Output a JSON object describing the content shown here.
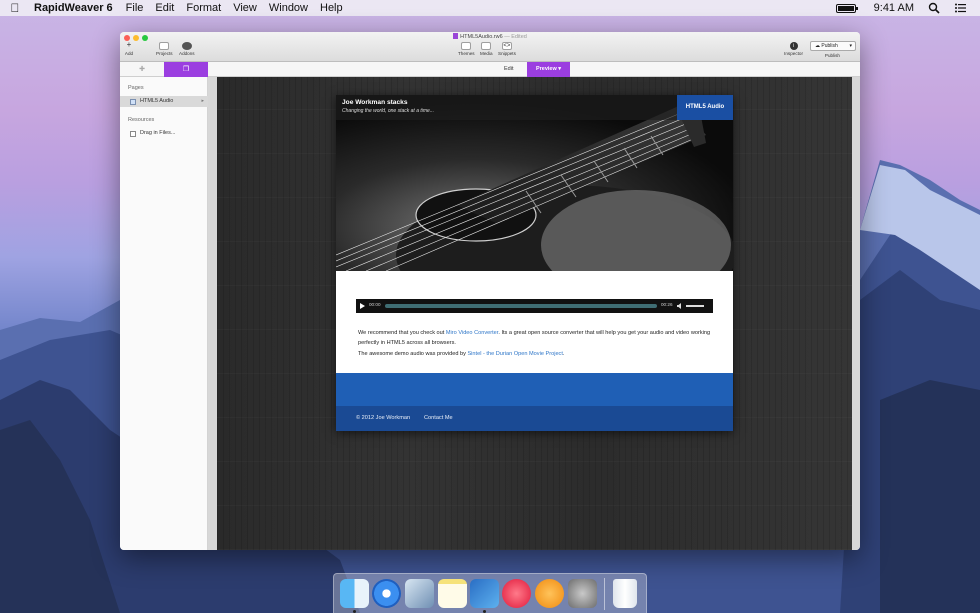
{
  "menubar": {
    "app_name": "RapidWeaver 6",
    "menus": [
      "File",
      "Edit",
      "Format",
      "View",
      "Window",
      "Help"
    ],
    "clock": "9:41 AM"
  },
  "window": {
    "doc_title": "HTML5Audio.rw6",
    "doc_status": "— Edited",
    "toolbar": {
      "add": "Add",
      "projects": "Projects",
      "addons": "Addons",
      "themes": "Themes",
      "media": "Media",
      "snippets": "Snippets",
      "inspector": "Inspector",
      "publish": "Publish",
      "publish_label": "Publish"
    },
    "tabs": {
      "edit": "Edit",
      "preview": "Preview"
    },
    "sidebar": {
      "pages_header": "Pages",
      "pages": [
        {
          "label": "HTML5 Audio"
        }
      ],
      "resources_header": "Resources",
      "resources": [
        {
          "label": "Drag in Files..."
        }
      ]
    }
  },
  "site": {
    "title": "Joe Workman stacks",
    "tagline": "Changing the world, one stack at a time...",
    "nav_item": "HTML5 Audio",
    "player": {
      "current": "00:00",
      "duration": "00:26"
    },
    "para1": {
      "pre": "We recommend that you check out ",
      "link": "Miro Video Converter",
      "post": ". Its a great open source converter that will help you get your audio and video working perfectly in HTML5 across all browsers."
    },
    "para2": {
      "pre": "The awesome demo audio was provided by ",
      "link": "Sintel - the Durian Open Movie Project",
      "post": "."
    },
    "footer": {
      "copyright": "© 2012 Joe Workman",
      "contact": "Contact Me"
    }
  },
  "dock": {
    "apps": [
      "finder-icon",
      "safari-icon",
      "preview-icon",
      "notes-icon",
      "xcode-icon",
      "itunes-icon",
      "ibooks-icon",
      "system-preferences-icon",
      "trash-icon"
    ]
  },
  "colors": {
    "accent": "#9b3ee0",
    "site_blue": "#1f5fb5",
    "footer_blue": "#1a4a94"
  }
}
